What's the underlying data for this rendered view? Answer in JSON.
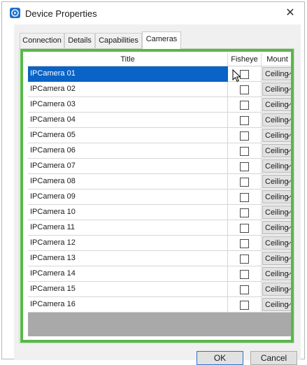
{
  "window": {
    "title": "Device Properties",
    "close_glyph": "✕"
  },
  "tabs": [
    {
      "label": "Connection",
      "active": false
    },
    {
      "label": "Details",
      "active": false
    },
    {
      "label": "Capabilities",
      "active": false
    },
    {
      "label": "Cameras",
      "active": true
    }
  ],
  "table": {
    "columns": [
      "Title",
      "Fisheye",
      "Mount Type"
    ],
    "rows": [
      {
        "title": "IPCamera 01",
        "fisheye": false,
        "mount": "Ceiling",
        "selected": true
      },
      {
        "title": "IPCamera 02",
        "fisheye": false,
        "mount": "Ceiling",
        "selected": false
      },
      {
        "title": "IPCamera 03",
        "fisheye": false,
        "mount": "Ceiling",
        "selected": false
      },
      {
        "title": "IPCamera 04",
        "fisheye": false,
        "mount": "Ceiling",
        "selected": false
      },
      {
        "title": "IPCamera 05",
        "fisheye": false,
        "mount": "Ceiling",
        "selected": false
      },
      {
        "title": "IPCamera 06",
        "fisheye": false,
        "mount": "Ceiling",
        "selected": false
      },
      {
        "title": "IPCamera 07",
        "fisheye": false,
        "mount": "Ceiling",
        "selected": false
      },
      {
        "title": "IPCamera 08",
        "fisheye": false,
        "mount": "Ceiling",
        "selected": false
      },
      {
        "title": "IPCamera 09",
        "fisheye": false,
        "mount": "Ceiling",
        "selected": false
      },
      {
        "title": "IPCamera 10",
        "fisheye": false,
        "mount": "Ceiling",
        "selected": false
      },
      {
        "title": "IPCamera 11",
        "fisheye": false,
        "mount": "Ceiling",
        "selected": false
      },
      {
        "title": "IPCamera 12",
        "fisheye": false,
        "mount": "Ceiling",
        "selected": false
      },
      {
        "title": "IPCamera 13",
        "fisheye": false,
        "mount": "Ceiling",
        "selected": false
      },
      {
        "title": "IPCamera 14",
        "fisheye": false,
        "mount": "Ceiling",
        "selected": false
      },
      {
        "title": "IPCamera 15",
        "fisheye": false,
        "mount": "Ceiling",
        "selected": false
      },
      {
        "title": "IPCamera 16",
        "fisheye": false,
        "mount": "Ceiling",
        "selected": false
      }
    ]
  },
  "buttons": {
    "ok": "OK",
    "cancel": "Cancel"
  },
  "colors": {
    "selection": "#0a63c6",
    "highlight_border": "#57b947",
    "app_icon": "#1c6fd0"
  },
  "icons": {
    "app": "play-circle-icon",
    "close": "close-icon",
    "dropdown": "chevron-down-icon",
    "cursor": "mouse-pointer-icon"
  }
}
